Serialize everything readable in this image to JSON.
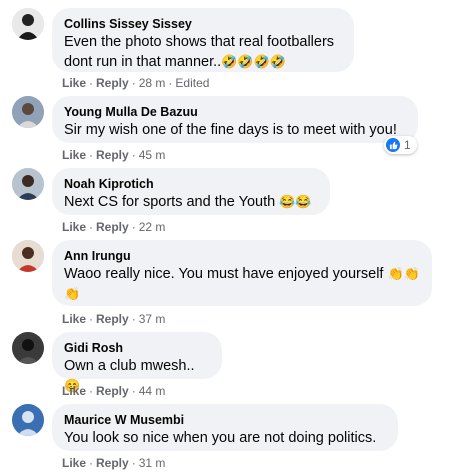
{
  "comments": [
    {
      "name": "Collins Sissey Sissey",
      "text": "Even the photo shows that real footballers dont run in that manner..",
      "emoji": "🤣🤣🤣🤣",
      "like": "Like",
      "reply": "Reply",
      "time": "28 m",
      "edited": "Edited"
    },
    {
      "name": "Young Mulla De Bazuu",
      "text": "Sir my wish one of the fine days is to meet with you!",
      "like": "Like",
      "reply": "Reply",
      "time": "45 m",
      "reaction_count": "1",
      "reaction_icon": "like-thumb-icon"
    },
    {
      "name": "Noah Kiprotich",
      "text": "Next CS for sports and the Youth ",
      "emoji": "😂😂",
      "like": "Like",
      "reply": "Reply",
      "time": "22 m"
    },
    {
      "name": "Ann Irungu",
      "text": "Waoo really nice. You must have enjoyed yourself ",
      "emoji": "👏👏",
      "emoji2": "👏",
      "like": "Like",
      "reply": "Reply",
      "time": "37 m"
    },
    {
      "name": "Gidi Rosh",
      "text": "Own a club mwesh..",
      "emoji": "😊",
      "like": "Like",
      "reply": "Reply",
      "time": "44 m"
    },
    {
      "name": "Maurice W Musembi",
      "text": "You look so nice when you are not doing politics.",
      "like": "Like",
      "reply": "Reply",
      "time": "31 m"
    }
  ],
  "colors": {
    "bubble": "#f0f2f5",
    "meta": "#65676b",
    "like_blue": "#1877f2"
  }
}
